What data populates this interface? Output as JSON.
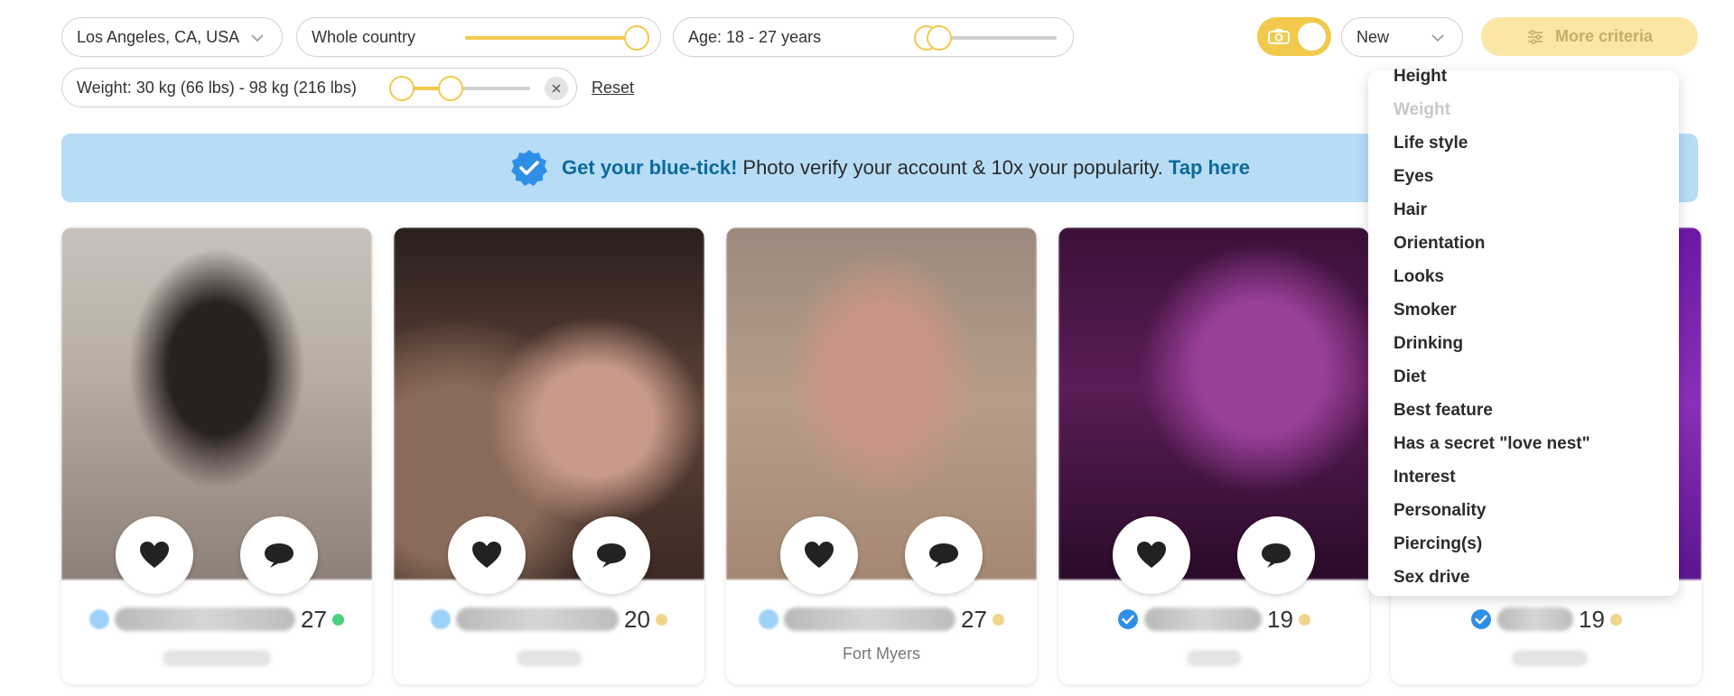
{
  "filters": {
    "location": "Los Angeles, CA, USA",
    "distance": "Whole country",
    "age": "Age: 18 - 27 years",
    "weight": "Weight: 30 kg (66 lbs) - 98 kg (216 lbs)",
    "sort": "New",
    "more_criteria": "More criteria",
    "reset": "Reset",
    "photo_only_enabled": true
  },
  "banner": {
    "strong": "Get your blue-tick!",
    "text": "Photo verify your account & 10x your popularity.",
    "link": "Tap here"
  },
  "criteria_menu": [
    {
      "label": "Height",
      "disabled": false
    },
    {
      "label": "Weight",
      "disabled": true
    },
    {
      "label": "Life style",
      "disabled": false
    },
    {
      "label": "Eyes",
      "disabled": false
    },
    {
      "label": "Hair",
      "disabled": false
    },
    {
      "label": "Orientation",
      "disabled": false
    },
    {
      "label": "Looks",
      "disabled": false
    },
    {
      "label": "Smoker",
      "disabled": false
    },
    {
      "label": "Drinking",
      "disabled": false
    },
    {
      "label": "Diet",
      "disabled": false
    },
    {
      "label": "Best feature",
      "disabled": false
    },
    {
      "label": "Has a secret \"love nest\"",
      "disabled": false
    },
    {
      "label": "Interest",
      "disabled": false
    },
    {
      "label": "Personality",
      "disabled": false
    },
    {
      "label": "Piercing(s)",
      "disabled": false
    },
    {
      "label": "Sex drive",
      "disabled": false
    }
  ],
  "cards": [
    {
      "age": "27",
      "city": "",
      "status": "online",
      "verified": false
    },
    {
      "age": "20",
      "city": "",
      "status": "away",
      "verified": false
    },
    {
      "age": "27",
      "city": "Fort Myers",
      "status": "away",
      "verified": false
    },
    {
      "age": "19",
      "city": "",
      "status": "away",
      "verified": true
    },
    {
      "age": "19",
      "city": "",
      "status": "away",
      "verified": true
    }
  ],
  "colors": {
    "accent": "#f2c94c",
    "banner_bg": "#b7dcf6",
    "link": "#0d6a99",
    "online": "#4cd07d",
    "away": "#f0d48a",
    "verified": "#2f8fe8"
  },
  "icons": {
    "heart": "heart-icon",
    "chat": "chat-bubble-icon",
    "camera": "camera-icon",
    "filter": "sliders-icon",
    "verified": "verified-badge-icon",
    "clear": "close-icon",
    "chevron": "chevron-down-icon"
  }
}
